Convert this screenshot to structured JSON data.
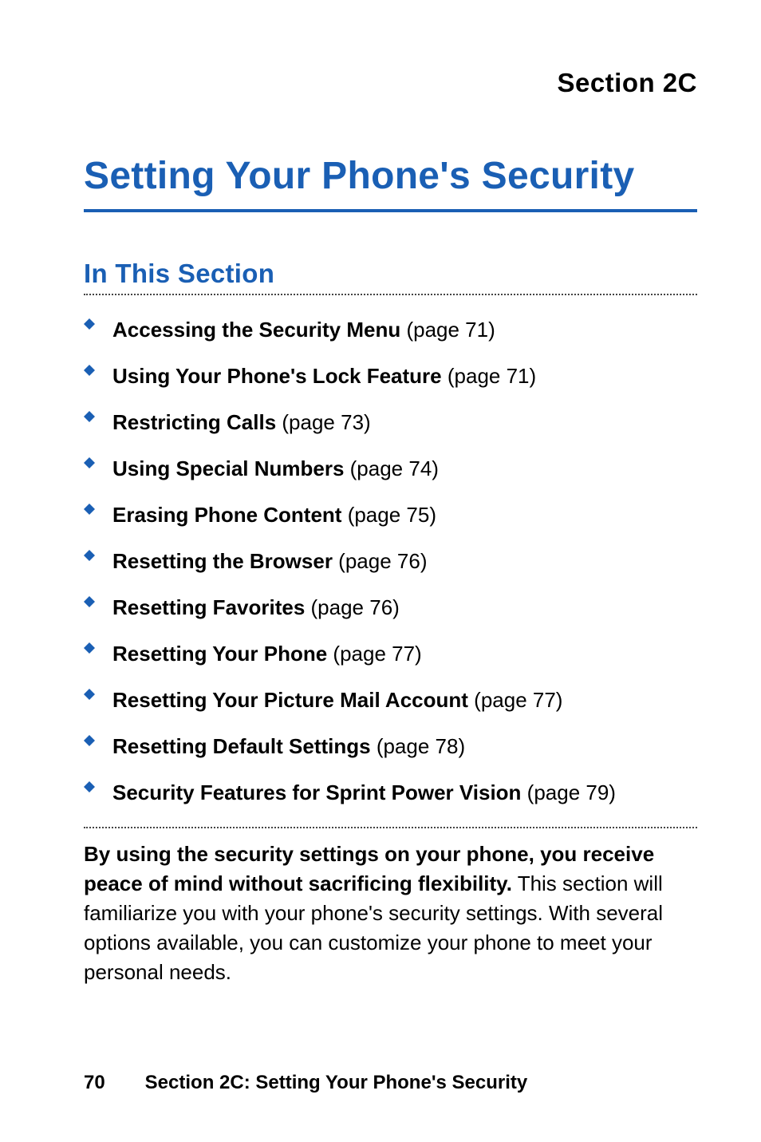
{
  "header": {
    "section_label": "Section 2C"
  },
  "title": "Setting Your Phone's Security",
  "subhead": "In This Section",
  "toc": [
    {
      "bold": "Accessing the Security Menu",
      "rest": " (page 71)"
    },
    {
      "bold": "Using Your Phone's Lock Feature",
      "rest": " (page 71)"
    },
    {
      "bold": "Restricting Calls",
      "rest": " (page 73)"
    },
    {
      "bold": "Using Special Numbers",
      "rest": " (page 74)"
    },
    {
      "bold": "Erasing Phone Content",
      "rest": " (page 75)"
    },
    {
      "bold": "Resetting the Browser",
      "rest": " (page 76)"
    },
    {
      "bold": "Resetting Favorites",
      "rest": " (page 76)"
    },
    {
      "bold": "Resetting Your Phone",
      "rest": " (page 77)"
    },
    {
      "bold": "Resetting Your Picture Mail Account",
      "rest": " (page 77)"
    },
    {
      "bold": "Resetting Default Settings",
      "rest": " (page 78)"
    },
    {
      "bold": "Security Features for Sprint Power Vision",
      "rest": " (page 79)"
    }
  ],
  "intro": {
    "bold": "By using the security settings on your phone, you receive peace of mind without sacrificing flexibility.",
    "rest": " This section will familiarize you with your phone's security settings. With several options available, you can customize your phone to meet your personal needs."
  },
  "footer": {
    "page_number": "70",
    "running_head": "Section 2C: Setting Your Phone's Security"
  },
  "colors": {
    "accent": "#1a5fb4"
  }
}
